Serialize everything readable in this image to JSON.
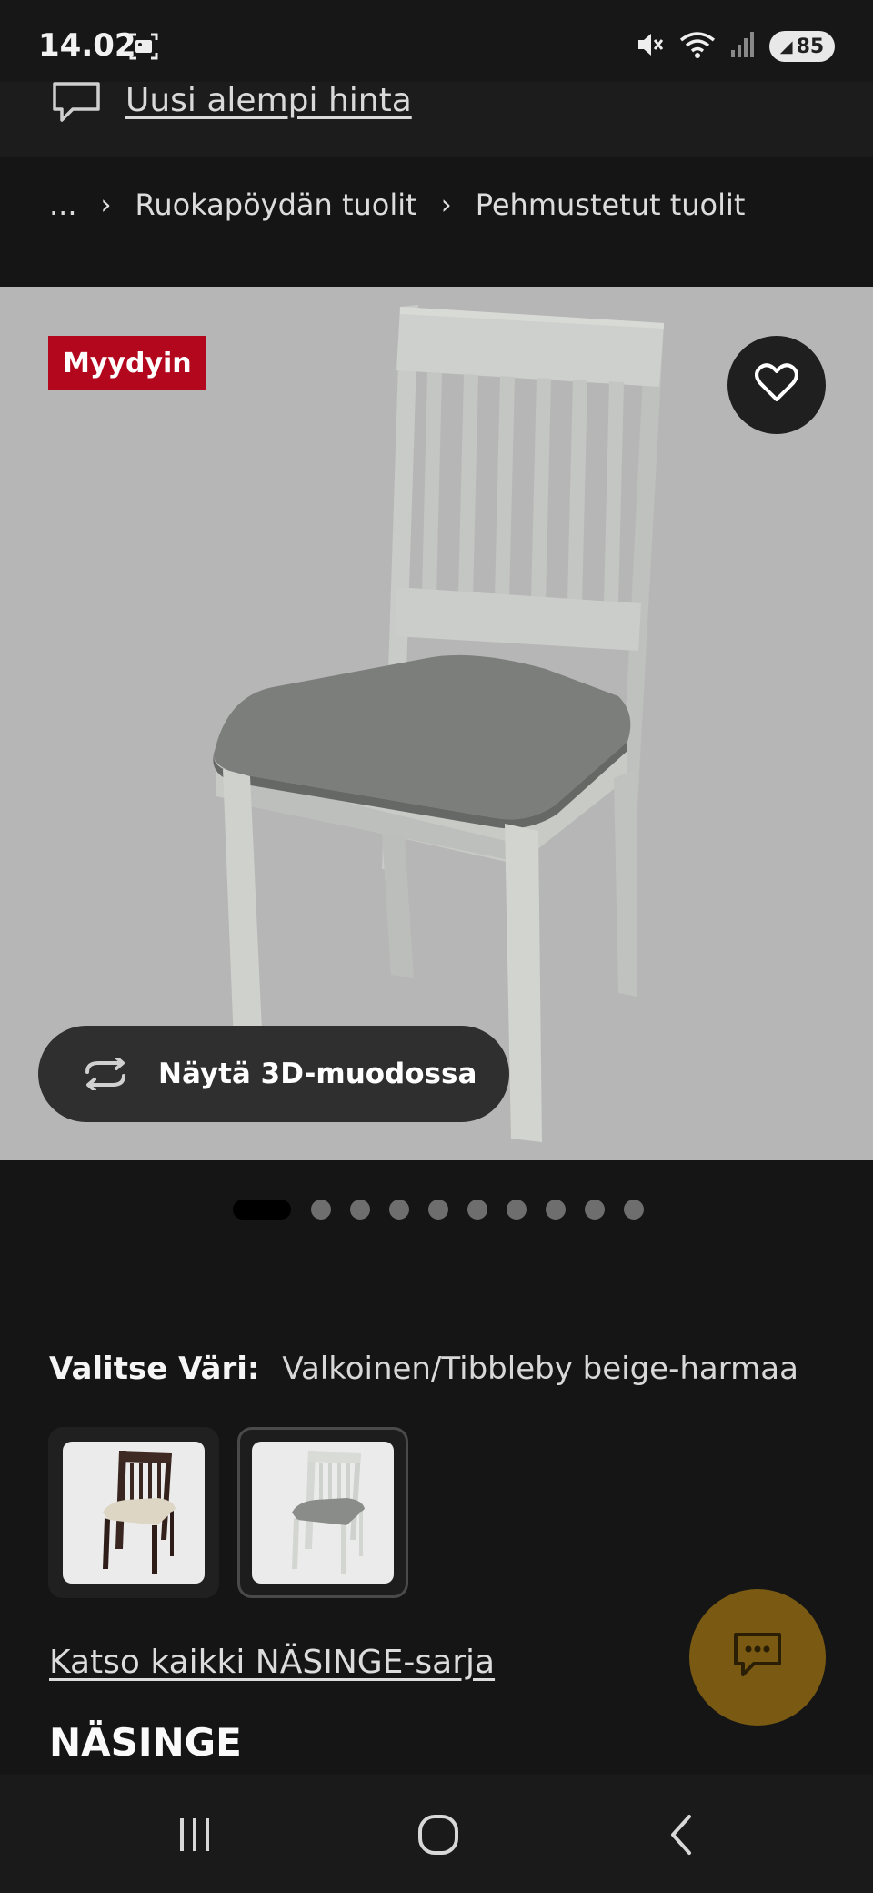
{
  "status": {
    "time": "14.02",
    "battery": "85",
    "icons": [
      "screenshot-icon",
      "mute-icon",
      "wifi-icon",
      "signal-icon",
      "battery-icon"
    ]
  },
  "notice": {
    "icon": "chat-bubble-icon",
    "link_label": "Uusi alempi hinta"
  },
  "breadcrumb": {
    "items": [
      "...",
      "Ruokapöydän tuolit",
      "Pehmustetut tuolit"
    ],
    "separator": "›"
  },
  "product_image": {
    "badge": "Myydyin",
    "favorite_icon": "heart-icon",
    "view3d_label": "Näytä 3D-muodossa",
    "view3d_icon": "rotate-arrows-icon",
    "gallery": {
      "total": 10,
      "current": 1
    }
  },
  "color_selector": {
    "label": "Valitse Väri:",
    "value": "Valkoinen/Tibbleby beige-harmaa",
    "options": [
      {
        "name": "dark-chair-swatch",
        "selected": false
      },
      {
        "name": "white-chair-swatch",
        "selected": true
      }
    ]
  },
  "series_link": "Katso kaikki NÄSINGE-sarja",
  "product_title": "NÄSINGE",
  "chat_button_icon": "chat-icon",
  "colors": {
    "background": "#151515",
    "badge": "#b3071d",
    "image_bg": "#b6b6b6",
    "chat_fab": "#7a5a12"
  },
  "nav": {
    "icons": [
      "recents-icon",
      "home-icon",
      "back-icon"
    ]
  }
}
